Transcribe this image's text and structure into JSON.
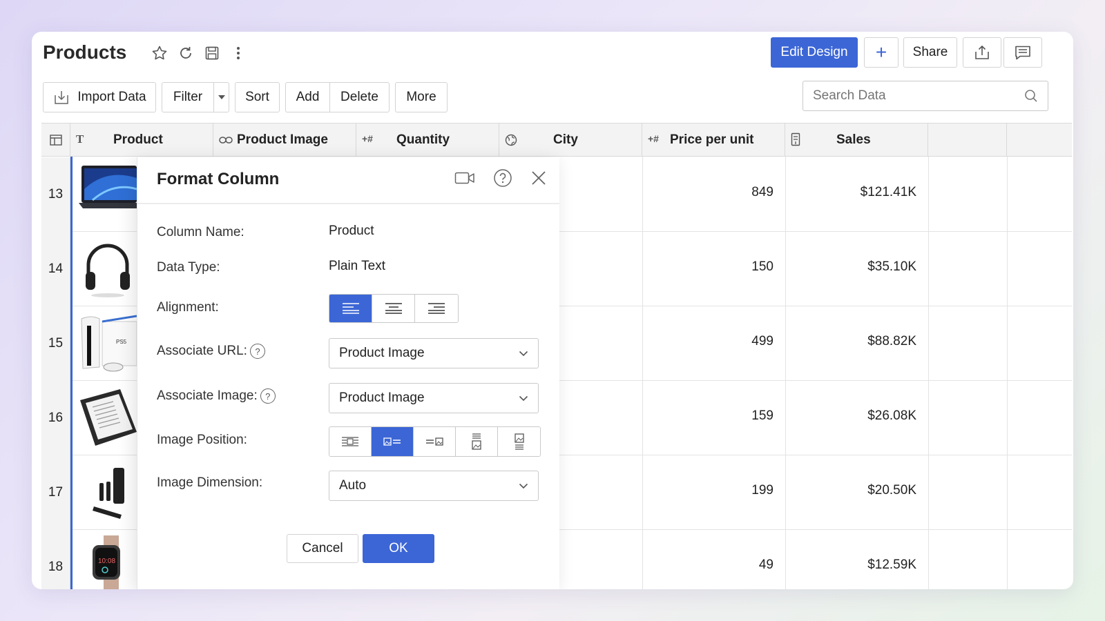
{
  "header": {
    "title": "Products",
    "icons": [
      "star-icon",
      "refresh-icon",
      "save-icon",
      "more-vertical-icon"
    ],
    "edit_design_label": "Edit Design",
    "add_label": "+",
    "share_label": "Share"
  },
  "toolbar": {
    "import_label": "Import Data",
    "filter_label": "Filter",
    "sort_label": "Sort",
    "add_label": "Add",
    "delete_label": "Delete",
    "more_label": "More"
  },
  "search": {
    "placeholder": "Search Data"
  },
  "columns": [
    {
      "label": "Product",
      "icon": "T"
    },
    {
      "label": "Product Image",
      "icon": "link-icon"
    },
    {
      "label": "Quantity",
      "icon": "+#"
    },
    {
      "label": "City",
      "icon": "globe-icon"
    },
    {
      "label": "Price per unit",
      "icon": "+#"
    },
    {
      "label": "Sales",
      "icon": "formula-icon"
    }
  ],
  "rows": [
    {
      "num": "13",
      "price": "849",
      "sales": "$121.41K",
      "image": "laptop"
    },
    {
      "num": "14",
      "price": "150",
      "sales": "$35.10K",
      "image": "headphones"
    },
    {
      "num": "15",
      "price": "499",
      "sales": "$88.82K",
      "image": "console"
    },
    {
      "num": "16",
      "price": "159",
      "sales": "$26.08K",
      "image": "tablet"
    },
    {
      "num": "17",
      "price": "199",
      "sales": "$20.50K",
      "image": "speakers"
    },
    {
      "num": "18",
      "price": "49",
      "sales": "$12.59K",
      "image": "smartwatch"
    }
  ],
  "dialog": {
    "title": "Format Column",
    "column_name_label": "Column Name:",
    "column_name_value": "Product",
    "data_type_label": "Data Type:",
    "data_type_value": "Plain Text",
    "alignment_label": "Alignment:",
    "alignment_selected": "left",
    "associate_url_label": "Associate URL:",
    "associate_url_value": "Product Image",
    "associate_image_label": "Associate Image:",
    "associate_image_value": "Product Image",
    "image_position_label": "Image Position:",
    "image_position_selected": 2,
    "image_dimension_label": "Image Dimension:",
    "image_dimension_value": "Auto",
    "help_glyph": "?",
    "cancel_label": "Cancel",
    "ok_label": "OK"
  },
  "colors": {
    "accent": "#3c66d6",
    "border": "#d3d3d3"
  }
}
